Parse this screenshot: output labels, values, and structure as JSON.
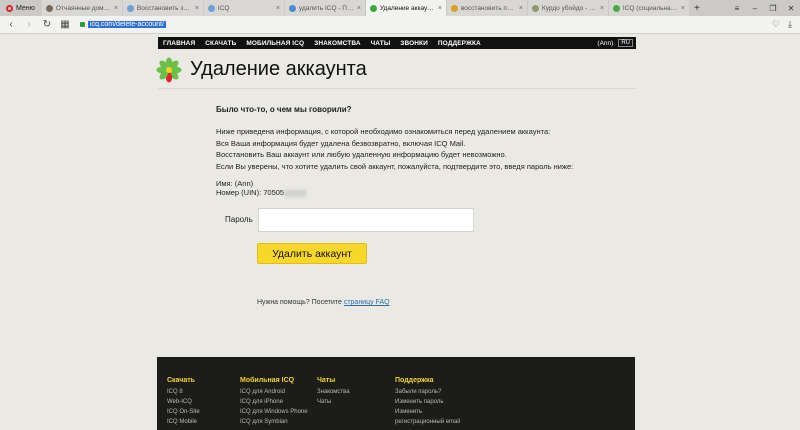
{
  "browser": {
    "menu_label": "Меню",
    "tabs": [
      {
        "label": "Отчаянные домохо...",
        "color": "#7a6a5a",
        "active": false
      },
      {
        "label": "Восстановить запи...",
        "color": "#6aa0d8",
        "active": false
      },
      {
        "label": "ICQ",
        "color": "#6aa0d8",
        "active": false
      },
      {
        "label": "удалить ICQ - Поиск...",
        "color": "#4a8ad8",
        "active": false
      },
      {
        "label": "Удаление аккаунта",
        "color": "#3aa83a",
        "active": true
      },
      {
        "label": "восстановить пароль...",
        "color": "#d8a020",
        "active": false
      },
      {
        "label": "Курдо убойдо - сот...",
        "color": "#8a9a6a",
        "active": false
      },
      {
        "label": "ICQ (социальная сеть)",
        "color": "#4aa84a",
        "active": false
      }
    ],
    "url": "icq.com/delete-account/"
  },
  "nav": {
    "items": [
      "ГЛАВНАЯ",
      "СКАЧАТЬ",
      "МОБИЛЬНАЯ ICQ",
      "ЗНАКОМСТВА",
      "ЧАТЫ",
      "ЗВОНКИ",
      "ПОДДЕРЖКА"
    ],
    "user": "(Ann)",
    "lang": "RU"
  },
  "page": {
    "title": "Удаление аккаунта",
    "question": "Было что-то, о чем мы говорили?",
    "info_lines": [
      "Ниже приведена информация, с которой необходимо ознакомиться перед удалением аккаунта:",
      "Вся Ваша информация будет удалена безвозвратно, включая ICQ Mail.",
      "Восстановить Ваш аккаунт или любую удаленную информацию будет невозможно.",
      "Если Вы уверены, что хотите удалить свой аккаунт, пожалуйста, подтвердите это, введя пароль ниже:"
    ],
    "name_line": "Имя: (Ann)",
    "uin_line": "Номер (UIN): 70505",
    "password_label": "Пароль",
    "password_value": "",
    "delete_button": "Удалить аккаунт",
    "help_text": "Нужна помощь? Посетите",
    "help_link": "страницу FAQ"
  },
  "footer": {
    "columns": [
      {
        "heading": "Скачать",
        "links": [
          "ICQ 8",
          "Web-ICQ",
          "ICQ On-Site",
          "ICQ Mobile"
        ]
      },
      {
        "heading": "Мобильная ICQ",
        "links": [
          "ICQ для Android",
          "ICQ для iPhone",
          "ICQ для Windows Phone",
          "ICQ для Symbian"
        ]
      },
      {
        "heading": "Чаты",
        "links": [
          "Знакомства",
          "Чаты"
        ]
      },
      {
        "heading": "Поддержка",
        "links": [
          "Забыли пароль?",
          "Изменить пароль",
          "Изменить",
          "регистрационный email"
        ]
      }
    ]
  },
  "colors": {
    "accent_yellow": "#f7d82a",
    "nav_black": "#111111",
    "link_blue": "#2a6fb0"
  }
}
